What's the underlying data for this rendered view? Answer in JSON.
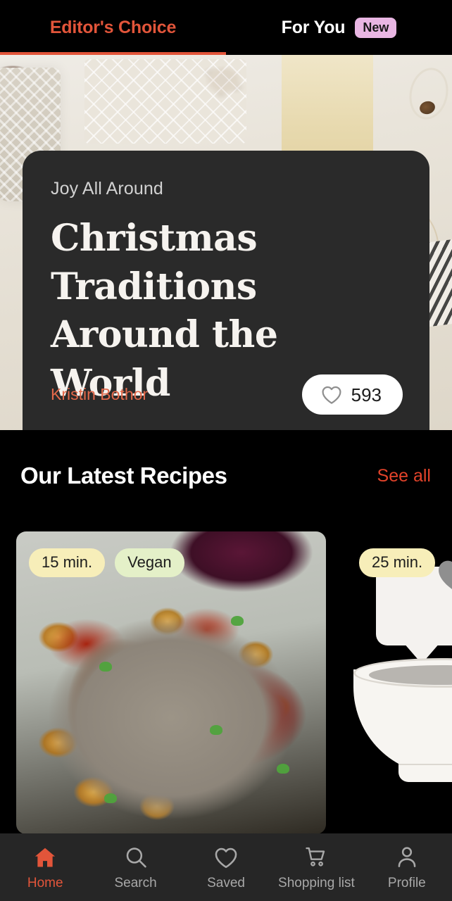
{
  "colors": {
    "accent_orange": "#e2553a",
    "accent_red": "#e2432a",
    "author_orange": "#e2684a",
    "badge_new_bg": "#e9b6e3",
    "badge_time_bg": "#f7eeb9",
    "badge_diet_bg": "#e4f0c8",
    "card_bg": "#2a2a2a",
    "page_bg": "#000000",
    "nav_bg": "#262626",
    "nav_inactive": "#a8a8a8"
  },
  "tabs": [
    {
      "label": "Editor's Choice",
      "active": true,
      "badge": null
    },
    {
      "label": "For You",
      "active": false,
      "badge": "New"
    }
  ],
  "hero": {
    "kicker": "Joy All Around",
    "title": "Christmas Traditions Around the World",
    "author": "Kristin Bothor",
    "likes": "593",
    "like_icon": "heart-outline-icon"
  },
  "latest": {
    "title": "Our Latest Recipes",
    "see_all": "See all",
    "cards": [
      {
        "time": "15 min.",
        "diet": "Vegan",
        "loaded": true
      },
      {
        "time": "25 min.",
        "diet": null,
        "loaded": false
      }
    ]
  },
  "bottom_nav": [
    {
      "label": "Home",
      "icon": "home-icon",
      "active": true
    },
    {
      "label": "Search",
      "icon": "search-icon",
      "active": false
    },
    {
      "label": "Saved",
      "icon": "heart-icon",
      "active": false
    },
    {
      "label": "Shopping list",
      "icon": "cart-icon",
      "active": false
    },
    {
      "label": "Profile",
      "icon": "person-icon",
      "active": false
    }
  ]
}
